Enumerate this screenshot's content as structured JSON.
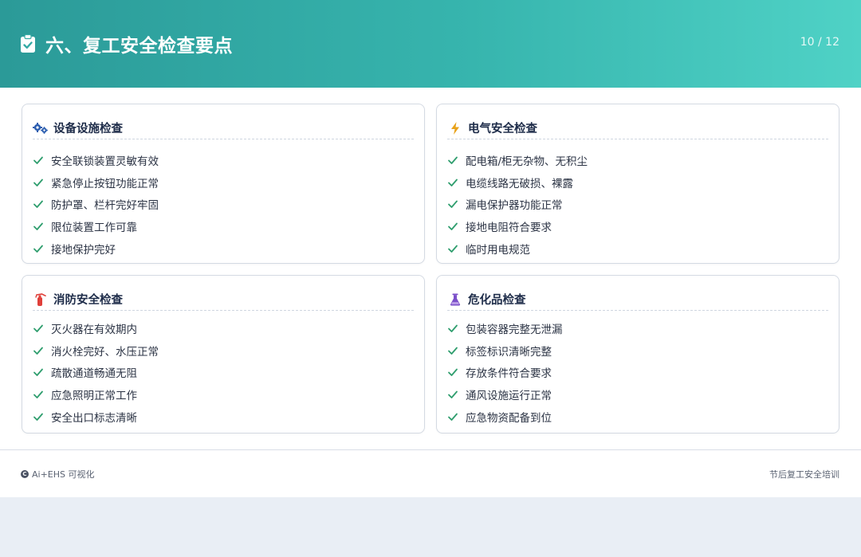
{
  "header": {
    "title": "六、复工安全检查要点",
    "page_indicator": "10 / 12",
    "icon": "clipboard-check-icon"
  },
  "cards": [
    {
      "title": "设备设施检查",
      "icon": "gears-icon",
      "icon_color": "#2d5fb0",
      "items": [
        "安全联锁装置灵敏有效",
        "紧急停止按钮功能正常",
        "防护罩、栏杆完好牢固",
        "限位装置工作可靠",
        "接地保护完好"
      ]
    },
    {
      "title": "电气安全检查",
      "icon": "bolt-icon",
      "icon_color": "#e8a21a",
      "items": [
        "配电箱/柜无杂物、无积尘",
        "电缆线路无破损、裸露",
        "漏电保护器功能正常",
        "接地电阻符合要求",
        "临时用电规范"
      ]
    },
    {
      "title": "消防安全检查",
      "icon": "fire-extinguisher-icon",
      "icon_color": "#e0403a",
      "items": [
        "灭火器在有效期内",
        "消火栓完好、水压正常",
        "疏散通道畅通无阻",
        "应急照明正常工作",
        "安全出口标志清晰"
      ]
    },
    {
      "title": "危化品检查",
      "icon": "flask-icon",
      "icon_color": "#7b4fc9",
      "items": [
        "包装容器完整无泄漏",
        "标签标识清晰完整",
        "存放条件符合要求",
        "通风设施运行正常",
        "应急物资配备到位"
      ]
    }
  ],
  "check_color": "#2f9e6e",
  "footer": {
    "left": "Ai+EHS 可视化",
    "left_icon": "c-circle-icon",
    "right": "节后复工安全培训"
  }
}
